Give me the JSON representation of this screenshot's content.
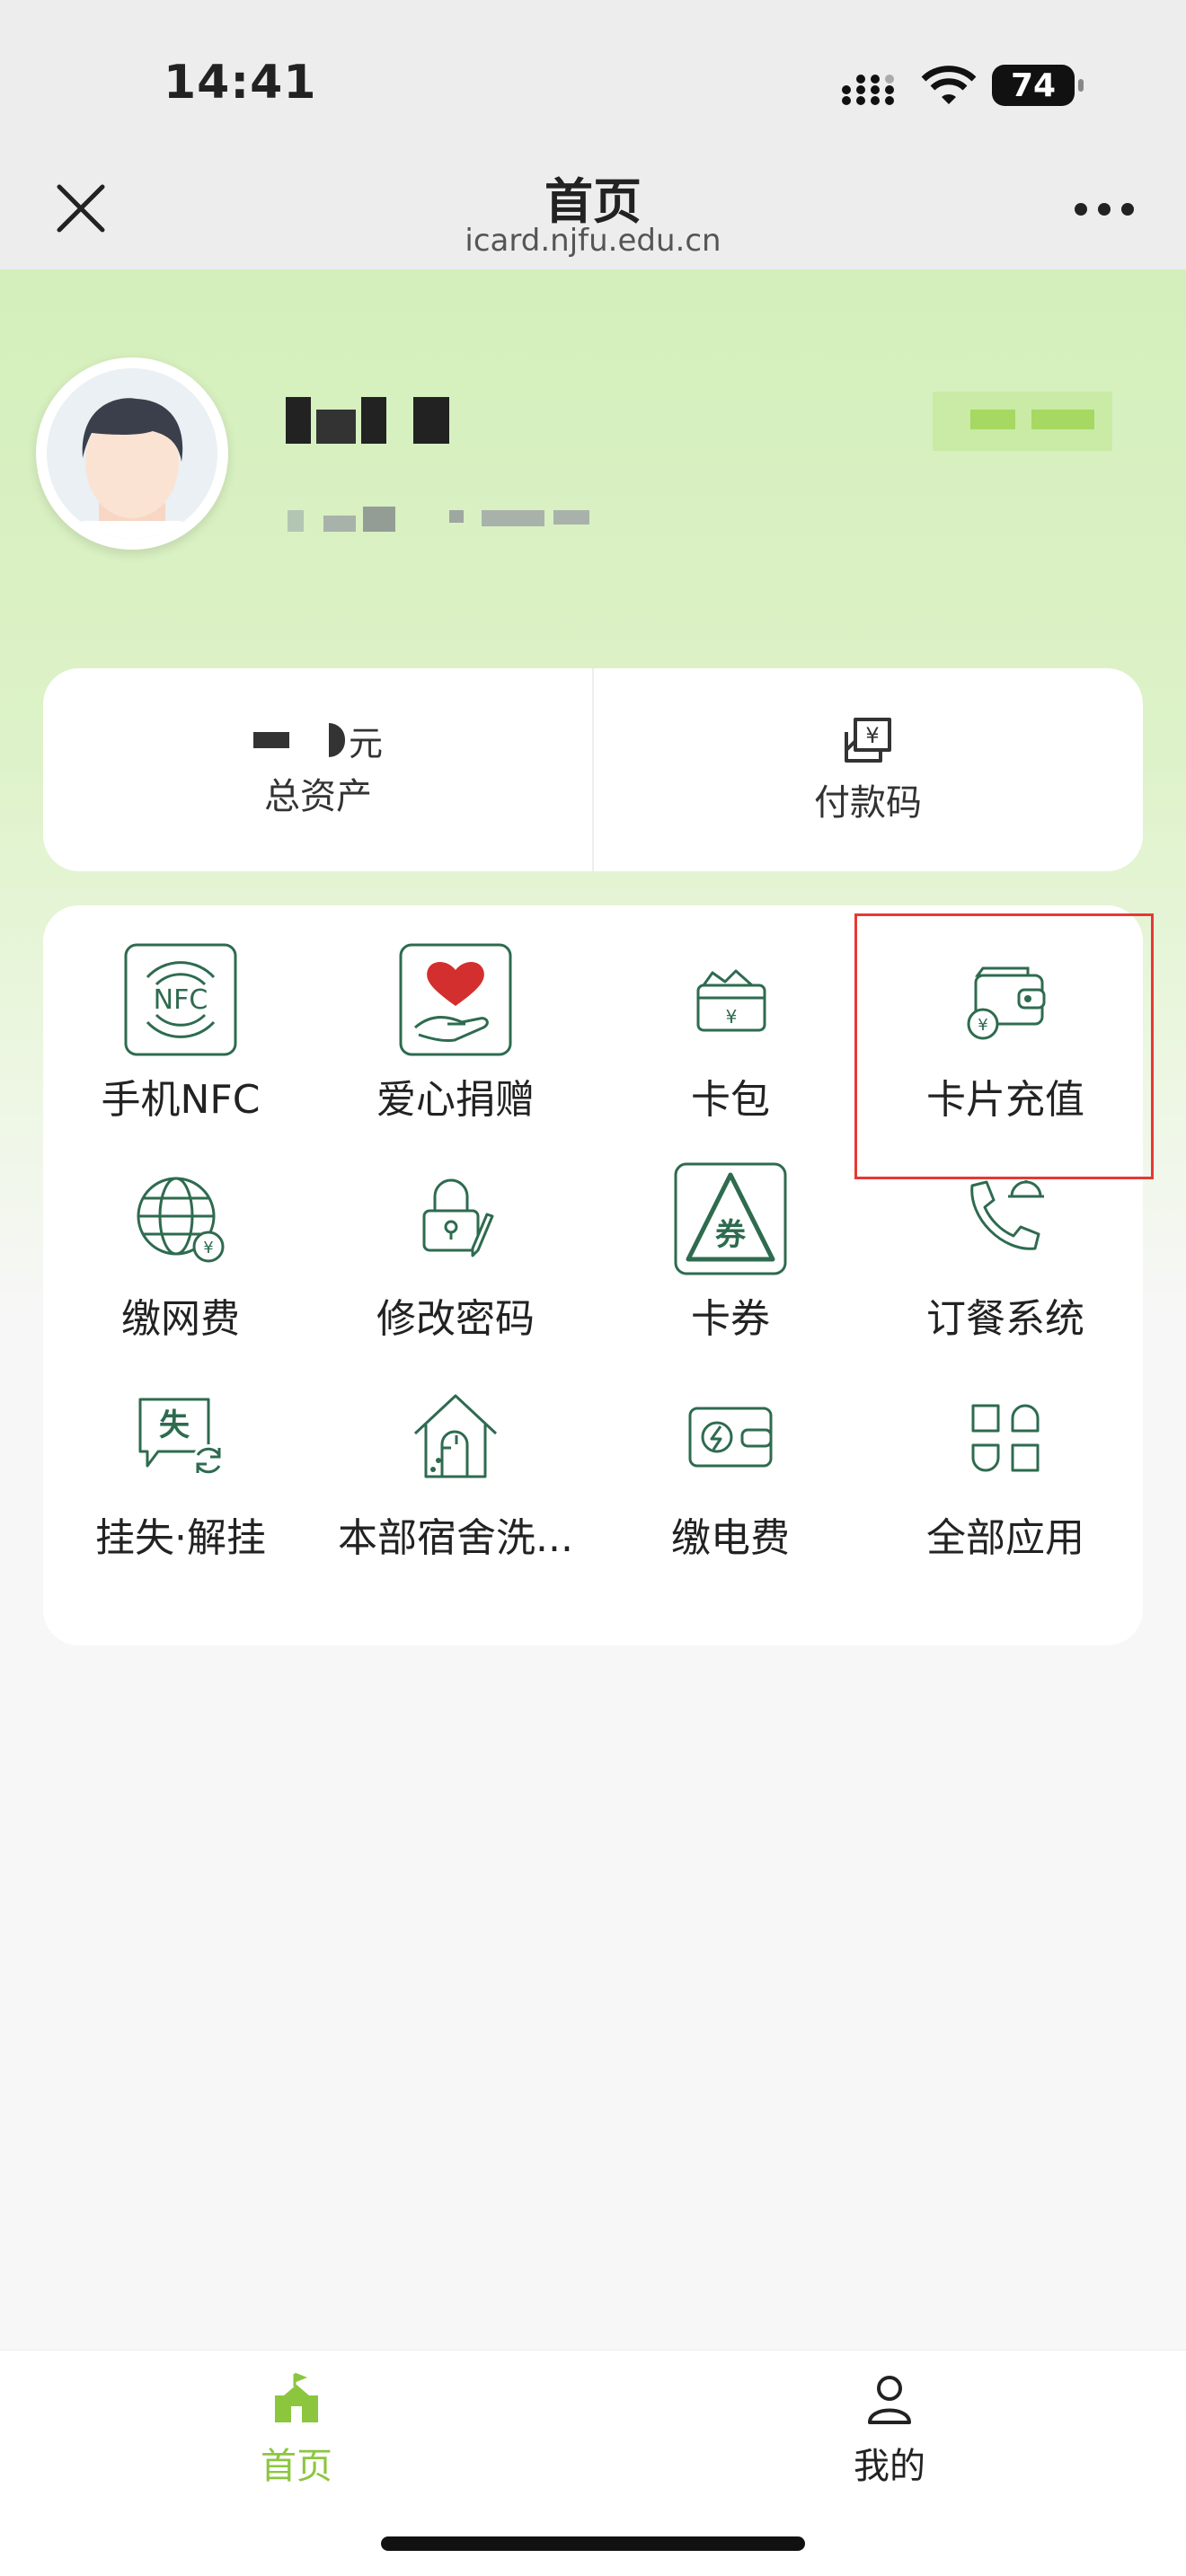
{
  "status_bar": {
    "time": "14:41",
    "battery": "74"
  },
  "nav": {
    "title": "首页",
    "url": "icard.njfu.edu.cn"
  },
  "assets": {
    "unit": "元",
    "total_label": "总资产",
    "pay_code_label": "付款码"
  },
  "apps": [
    {
      "label": "手机NFC",
      "icon": "nfc-icon"
    },
    {
      "label": "爱心捐赠",
      "icon": "heart-hand-icon"
    },
    {
      "label": "卡包",
      "icon": "card-wallet-icon"
    },
    {
      "label": "卡片充值",
      "icon": "wallet-recharge-icon"
    },
    {
      "label": "缴网费",
      "icon": "globe-yuan-icon"
    },
    {
      "label": "修改密码",
      "icon": "lock-pen-icon"
    },
    {
      "label": "卡券",
      "icon": "coupon-icon"
    },
    {
      "label": "订餐系统",
      "icon": "phone-dish-icon"
    },
    {
      "label": "挂失·解挂",
      "icon": "report-loss-icon"
    },
    {
      "label": "本部宿舍洗...",
      "icon": "house-faucet-icon"
    },
    {
      "label": "缴电费",
      "icon": "electric-card-icon"
    },
    {
      "label": "全部应用",
      "icon": "grid-icon"
    }
  ],
  "tabbar": {
    "home_label": "首页",
    "mine_label": "我的"
  },
  "colors": {
    "accent_green": "#8cc63f",
    "icon_green": "#2e6b4f",
    "highlight_red": "#e53935"
  }
}
